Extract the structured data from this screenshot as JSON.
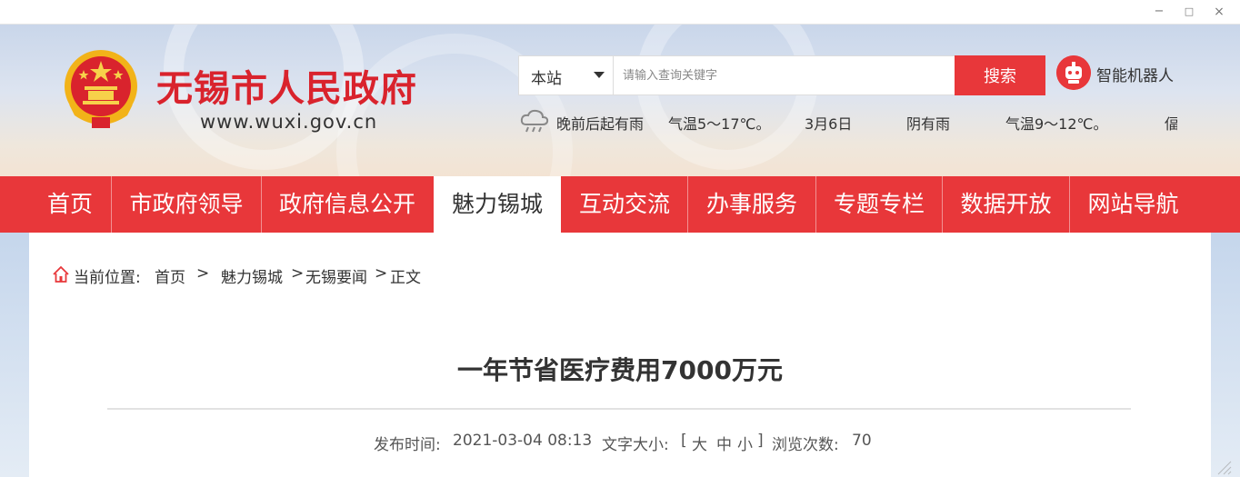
{
  "window": {
    "minimize": "−",
    "maximize": "□",
    "close": "×"
  },
  "header": {
    "site_title": "无锡市人民政府",
    "site_url": "www.wuxi.gov.cn",
    "search": {
      "scope": "本站",
      "placeholder": "请输入查询关键字",
      "button": "搜索"
    },
    "robot_label": "智能机器人",
    "weather": {
      "tonight": "晚前后起有雨",
      "tonight_temp": "气温5～17℃。",
      "date": "3月6日",
      "condition": "阴有雨",
      "temp": "气温9～12℃。",
      "overflow": "偪"
    }
  },
  "nav": {
    "items": [
      "首页",
      "市政府领导",
      "政府信息公开",
      "魅力锡城",
      "互动交流",
      "办事服务",
      "专题专栏",
      "数据开放",
      "网站导航"
    ],
    "active_index": 3
  },
  "breadcrumb": {
    "prefix": "当前位置:",
    "home": "首页",
    "sep1": ">",
    "section": "魅力锡城",
    "sep2": ">",
    "subsection": "无锡要闻",
    "sep3": ">",
    "current": "正文"
  },
  "article": {
    "title": "一年节省医疗费用7000万元",
    "publish_label": "发布时间:",
    "publish_time": "2021-03-04 08:13",
    "font_size_label": "文字大小:",
    "bracket_open": "[",
    "font_large": "大",
    "font_medium": "中",
    "font_small": "小",
    "bracket_close": "]",
    "views_label": "浏览次数:",
    "views": "70"
  },
  "colors": {
    "brand_red": "#e8373a",
    "title_red": "#d9232d"
  }
}
